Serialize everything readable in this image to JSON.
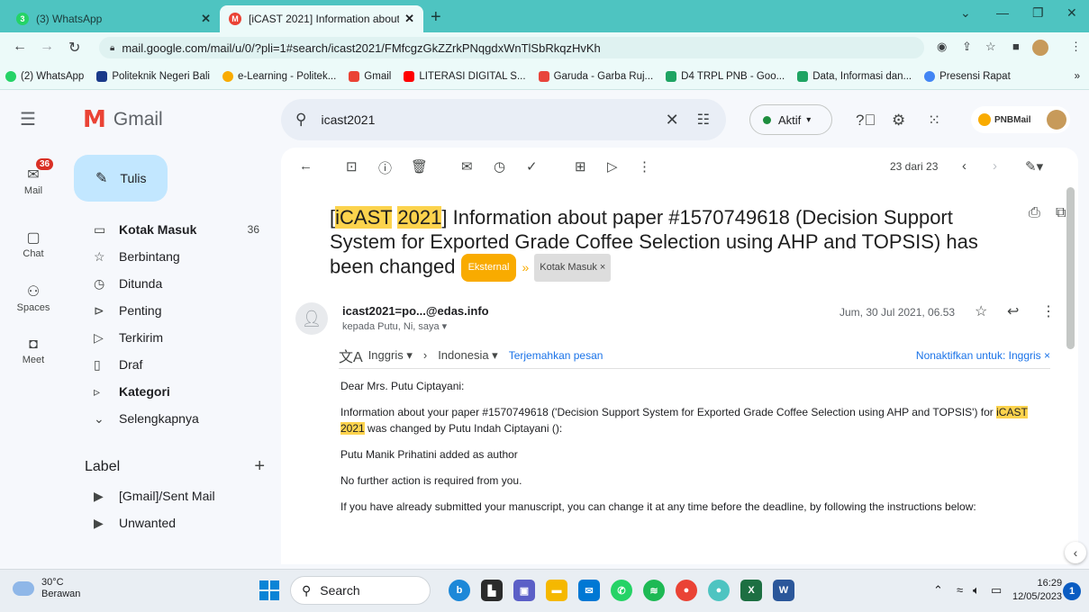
{
  "browser": {
    "tabs": [
      {
        "label": "(3) WhatsApp",
        "icon": "whatsapp-icon"
      },
      {
        "label": "[iCAST 2021] Information about",
        "icon": "gmail-icon"
      }
    ],
    "url": "mail.google.com/mail/u/0/?pli=1#search/icast2021/FMfcgzGkZZrkPNqgdxWnTlSbRkqzHvKh",
    "bookmarks": [
      {
        "label": "(2) WhatsApp",
        "color": "#25d366"
      },
      {
        "label": "Politeknik Negeri Bali",
        "color": "#1a3a8a"
      },
      {
        "label": "e-Learning - Politek...",
        "color": "#f9ab00"
      },
      {
        "label": "Gmail",
        "color": "#ea4335"
      },
      {
        "label": "LITERASI DIGITAL S...",
        "color": "#ff0000"
      },
      {
        "label": "Garuda - Garba Ruj...",
        "color": "#e8453c"
      },
      {
        "label": "D4 TRPL PNB - Goo...",
        "color": "#1fa463"
      },
      {
        "label": "Data, Informasi dan...",
        "color": "#1fa463"
      },
      {
        "label": "Presensi Rapat",
        "color": "#4285f4"
      }
    ],
    "more_bookmarks": "»"
  },
  "gmail": {
    "app_name": "Gmail",
    "search_value": "icast2021",
    "status_label": "Aktif",
    "brand_badge": "PNBMail",
    "rail": [
      {
        "label": "Mail",
        "badge": "36"
      },
      {
        "label": "Chat"
      },
      {
        "label": "Spaces"
      },
      {
        "label": "Meet"
      }
    ],
    "compose_label": "Tulis",
    "folders": [
      {
        "label": "Kotak Masuk",
        "count": "36",
        "icon": "▭"
      },
      {
        "label": "Berbintang",
        "count": "",
        "icon": "☆"
      },
      {
        "label": "Ditunda",
        "count": "",
        "icon": "◷"
      },
      {
        "label": "Penting",
        "count": "",
        "icon": "⊳"
      },
      {
        "label": "Terkirim",
        "count": "",
        "icon": "▷"
      },
      {
        "label": "Draf",
        "count": "",
        "icon": "▯"
      },
      {
        "label": "Kategori",
        "count": "",
        "icon": "▹"
      },
      {
        "label": "Selengkapnya",
        "count": "",
        "icon": "⌄"
      }
    ],
    "labels_header": "Label",
    "labels": [
      "[Gmail]/Sent Mail",
      "Unwanted"
    ]
  },
  "message": {
    "pagination": "23 dari 23",
    "subject_hl1": "iCAST",
    "subject_hl2": "2021",
    "subject_rest": "] Information about paper #1570749618 (Decision Support System for Exported Grade Coffee Selection using AHP and TOPSIS) has been changed",
    "chip_external": "Eksternal",
    "chip_inbox": "Kotak Masuk ×",
    "sender": "icast2021=po...@edas.info",
    "recipients": "kepada Putu, Ni, saya ▾",
    "date": "Jum, 30 Jul 2021, 06.53",
    "translate_from": "Inggris ▾",
    "translate_to": "Indonesia ▾",
    "translate_link": "Terjemahkan pesan",
    "translate_off": "Nonaktifkan untuk: Inggris ×",
    "greeting": "Dear Mrs. Putu Ciptayani:",
    "para1_pre": "Information about your paper #1570749618 ('Decision Support System for Exported Grade Coffee Selection using AHP and TOPSIS') for ",
    "para1_hl1": "iCAST",
    "para1_hl2": "2021",
    "para1_post": " was changed by Putu Indah Ciptayani ():",
    "para2": "Putu Manik Prihatini added as author",
    "para3": "No further action is required from you.",
    "para4": "If you have already submitted your manuscript, you can change it at any time before the deadline, by following the instructions below:"
  },
  "taskbar": {
    "temp": "30°C",
    "weather": "Berawan",
    "search_label": "Search",
    "time": "16:29",
    "date": "12/05/2023",
    "notifications": "1"
  }
}
